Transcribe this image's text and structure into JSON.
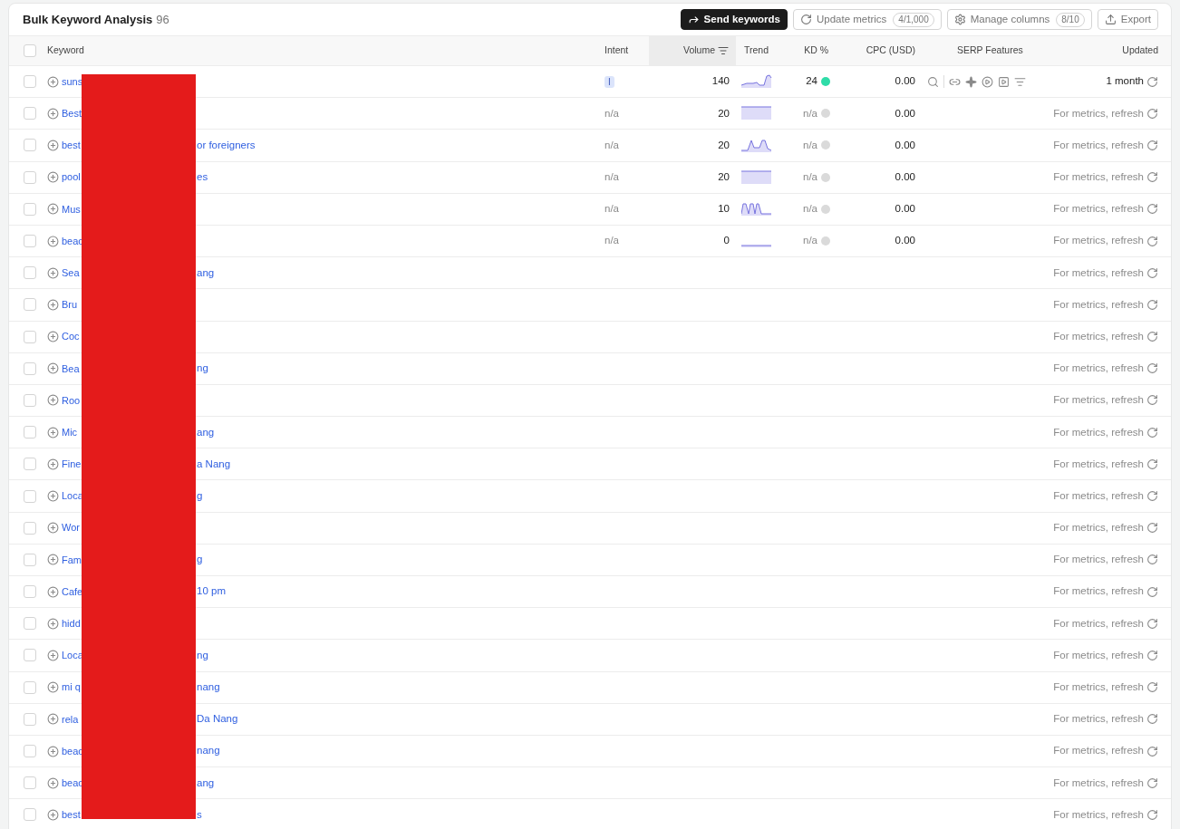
{
  "header": {
    "title": "Bulk Keyword Analysis",
    "count": "96"
  },
  "buttons": [
    {
      "label": "Send keywords",
      "kind": "send",
      "primary": true
    },
    {
      "label": "Update metrics",
      "kind": "update",
      "primary": false,
      "badge": "4/1,000"
    },
    {
      "label": "Manage columns",
      "kind": "columns",
      "primary": false,
      "badge": "8/10"
    },
    {
      "label": "Export",
      "kind": "export",
      "primary": false
    }
  ],
  "table": {
    "select_all": {
      "checked": false
    },
    "columns": [
      {
        "label": "Keyword",
        "sorted": false
      },
      {
        "label": "Intent",
        "sorted": false
      },
      {
        "label": "Volume",
        "sorted": true
      },
      {
        "label": "Trend",
        "sorted": false
      },
      {
        "label": "KD %",
        "sorted": false
      },
      {
        "label": "CPC (USD)",
        "sorted": false
      },
      {
        "label": "SERP Features",
        "sorted": false
      },
      {
        "label": "Updated",
        "sorted": false
      }
    ],
    "rows": [
      {
        "checked": false,
        "keyword_start": "suns",
        "intent": {
          "label": "I",
          "kind": "badge"
        },
        "volume": "140",
        "trend": {
          "kind": "rising"
        },
        "kd": {
          "value": "24",
          "color": "#2fdca8"
        },
        "cpc": "0.00",
        "serp_features": true,
        "updated": {
          "text": "1 month",
          "kind": "fresh"
        }
      },
      {
        "checked": false,
        "keyword_start": "Best",
        "intent": {
          "label": "n/a",
          "kind": "plain"
        },
        "volume": "20",
        "trend": {
          "kind": "flat-high"
        },
        "kd": {
          "value": "n/a",
          "color": "#dadada"
        },
        "cpc": "0.00",
        "serp_features": false,
        "updated": {
          "text": "For metrics, refresh",
          "kind": "stale"
        }
      },
      {
        "checked": false,
        "keyword_start": "best",
        "keyword_end": "or foreigners",
        "intent": {
          "label": "n/a",
          "kind": "plain"
        },
        "volume": "20",
        "trend": {
          "kind": "double-peak"
        },
        "kd": {
          "value": "n/a",
          "color": "#dadada"
        },
        "cpc": "0.00",
        "serp_features": false,
        "updated": {
          "text": "For metrics, refresh",
          "kind": "stale"
        }
      },
      {
        "checked": false,
        "keyword_start": "pool",
        "keyword_end": "es",
        "intent": {
          "label": "n/a",
          "kind": "plain"
        },
        "volume": "20",
        "trend": {
          "kind": "flat-high"
        },
        "kd": {
          "value": "n/a",
          "color": "#dadada"
        },
        "cpc": "0.00",
        "serp_features": false,
        "updated": {
          "text": "For metrics, refresh",
          "kind": "stale"
        }
      },
      {
        "checked": false,
        "keyword_start": "Mus",
        "intent": {
          "label": "n/a",
          "kind": "plain"
        },
        "volume": "10",
        "trend": {
          "kind": "waves"
        },
        "kd": {
          "value": "n/a",
          "color": "#dadada"
        },
        "cpc": "0.00",
        "serp_features": false,
        "updated": {
          "text": "For metrics, refresh",
          "kind": "stale"
        }
      },
      {
        "checked": false,
        "keyword_start": "beac",
        "intent": {
          "label": "n/a",
          "kind": "plain"
        },
        "volume": "0",
        "trend": {
          "kind": "flat-low"
        },
        "kd": {
          "value": "n/a",
          "color": "#dadada"
        },
        "cpc": "0.00",
        "serp_features": false,
        "updated": {
          "text": "For metrics, refresh",
          "kind": "stale"
        }
      },
      {
        "checked": false,
        "keyword_start": "Sea",
        "keyword_end": "ang",
        "updated": {
          "text": "For metrics, refresh",
          "kind": "stale"
        }
      },
      {
        "checked": false,
        "keyword_start": "Bru",
        "updated": {
          "text": "For metrics, refresh",
          "kind": "stale"
        }
      },
      {
        "checked": false,
        "keyword_start": "Coc",
        "updated": {
          "text": "For metrics, refresh",
          "kind": "stale"
        }
      },
      {
        "checked": false,
        "keyword_start": "Bea",
        "keyword_end": "ng",
        "updated": {
          "text": "For metrics, refresh",
          "kind": "stale"
        }
      },
      {
        "checked": false,
        "keyword_start": "Roo",
        "updated": {
          "text": "For metrics, refresh",
          "kind": "stale"
        }
      },
      {
        "checked": false,
        "keyword_start": "Mic",
        "keyword_end": "ang",
        "updated": {
          "text": "For metrics, refresh",
          "kind": "stale"
        }
      },
      {
        "checked": false,
        "keyword_start": "Fine",
        "keyword_end": "a Nang",
        "updated": {
          "text": "For metrics, refresh",
          "kind": "stale"
        }
      },
      {
        "checked": false,
        "keyword_start": "Loca",
        "keyword_end": "g",
        "updated": {
          "text": "For metrics, refresh",
          "kind": "stale"
        }
      },
      {
        "checked": false,
        "keyword_start": "Wor",
        "updated": {
          "text": "For metrics, refresh",
          "kind": "stale"
        }
      },
      {
        "checked": false,
        "keyword_start": "Fam",
        "keyword_end": "g",
        "updated": {
          "text": "For metrics, refresh",
          "kind": "stale"
        }
      },
      {
        "checked": false,
        "keyword_start": "Cafe",
        "keyword_end": "10 pm",
        "updated": {
          "text": "For metrics, refresh",
          "kind": "stale"
        }
      },
      {
        "checked": false,
        "keyword_start": "hidd",
        "updated": {
          "text": "For metrics, refresh",
          "kind": "stale"
        }
      },
      {
        "checked": false,
        "keyword_start": "Loca",
        "keyword_end": "ng",
        "updated": {
          "text": "For metrics, refresh",
          "kind": "stale"
        }
      },
      {
        "checked": false,
        "keyword_start": "mi q",
        "keyword_end": "nang",
        "updated": {
          "text": "For metrics, refresh",
          "kind": "stale"
        }
      },
      {
        "checked": false,
        "keyword_start": "rela",
        "keyword_end": "Da Nang",
        "updated": {
          "text": "For metrics, refresh",
          "kind": "stale"
        }
      },
      {
        "checked": false,
        "keyword_start": "beac",
        "keyword_end": "nang",
        "updated": {
          "text": "For metrics, refresh",
          "kind": "stale"
        }
      },
      {
        "checked": false,
        "keyword_start": "beac",
        "keyword_end": "ang",
        "updated": {
          "text": "For metrics, refresh",
          "kind": "stale"
        }
      },
      {
        "checked": false,
        "keyword_start": "best",
        "keyword_end": "s",
        "updated": {
          "text": "For metrics, refresh",
          "kind": "stale"
        }
      }
    ]
  }
}
